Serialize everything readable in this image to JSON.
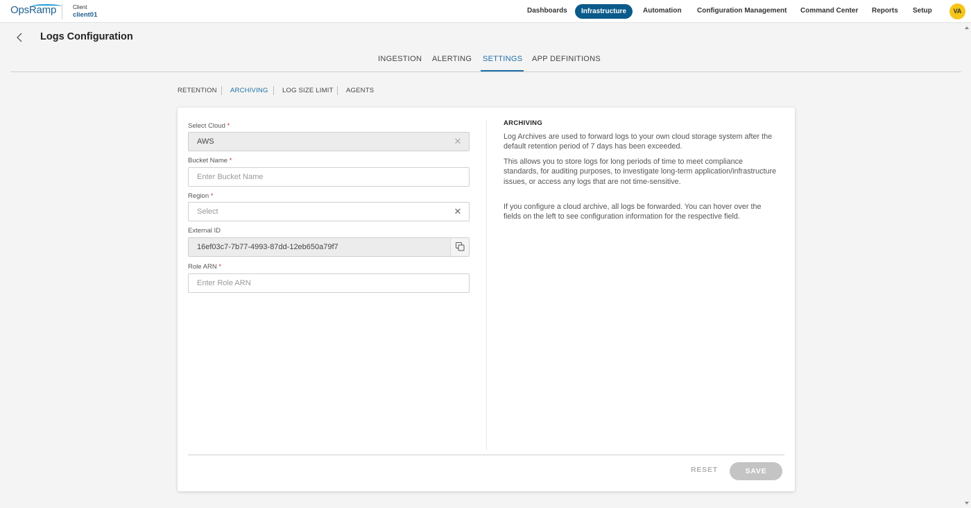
{
  "brand": {
    "logo": "OpsRamp"
  },
  "client": {
    "label": "Client",
    "name": "client01"
  },
  "nav": {
    "items": [
      {
        "label": "Dashboards"
      },
      {
        "label": "Infrastructure",
        "active": true
      },
      {
        "label": "Automation"
      },
      {
        "label": "Configuration Management"
      },
      {
        "label": "Command Center"
      },
      {
        "label": "Reports"
      },
      {
        "label": "Setup"
      }
    ],
    "avatar": "VA"
  },
  "page": {
    "title": "Logs Configuration"
  },
  "tabs": [
    {
      "label": "INGESTION"
    },
    {
      "label": "ALERTING"
    },
    {
      "label": "SETTINGS",
      "active": true
    },
    {
      "label": "APP DEFINITIONS"
    }
  ],
  "subtabs": [
    {
      "label": "RETENTION"
    },
    {
      "label": "ARCHIVING",
      "active": true
    },
    {
      "label": "LOG SIZE LIMIT"
    },
    {
      "label": "AGENTS"
    }
  ],
  "form": {
    "required_mark": "*",
    "select_cloud": {
      "label": "Select Cloud",
      "value": "AWS"
    },
    "bucket_name": {
      "label": "Bucket Name",
      "placeholder": "Enter Bucket Name"
    },
    "region": {
      "label": "Region",
      "placeholder": "Select"
    },
    "external_id": {
      "label": "External ID",
      "value": "16ef03c7-7b77-4993-87dd-12eb650a79f7"
    },
    "role_arn": {
      "label": "Role ARN",
      "placeholder": "Enter Role ARN"
    }
  },
  "info": {
    "title": "ARCHIVING",
    "paragraphs": [
      "Log Archives are used to forward logs to your own cloud storage system after the default retention period of 7 days has been exceeded.",
      "This allows you to store logs for long periods of time to meet compliance standards, for auditing purposes, to investigate long-term application/infrastructure issues, or access any logs that are not time-sensitive.",
      "If you configure a cloud archive, all logs be forwarded. You can hover over the fields on the left to see configuration information for the respective field."
    ]
  },
  "actions": {
    "reset": "RESET",
    "save": "SAVE"
  },
  "colors": {
    "accent": "#0a5a8a",
    "link": "#1f6fa8",
    "required": "#d62e2e",
    "avatar": "#f5c518"
  }
}
